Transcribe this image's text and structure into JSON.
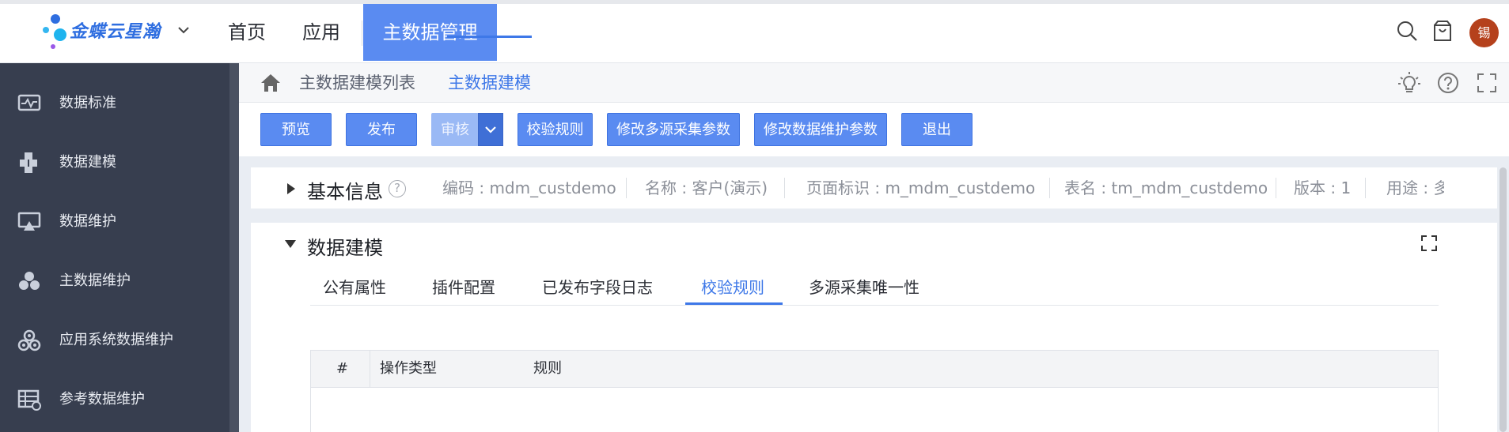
{
  "header": {
    "brand": "金蝶云星瀚",
    "nav": [
      "首页",
      "应用",
      "主数据管理"
    ],
    "avatar_text": "锡"
  },
  "sidebar": {
    "items": [
      {
        "label": "数据标准",
        "icon": "chart-monitor-icon"
      },
      {
        "label": "数据建模",
        "icon": "blocks-icon"
      },
      {
        "label": "数据维护",
        "icon": "monitor-icon"
      },
      {
        "label": "主数据维护",
        "icon": "cluster-icon"
      },
      {
        "label": "应用系统数据维护",
        "icon": "gears-icon"
      },
      {
        "label": "参考数据维护",
        "icon": "table-icon"
      }
    ]
  },
  "breadcrumb": {
    "items": [
      "主数据建模列表",
      "主数据建模"
    ]
  },
  "toolbar": {
    "buttons": [
      "预览",
      "发布",
      "审核",
      "校验规则",
      "修改多源采集参数",
      "修改数据维护参数",
      "退出"
    ]
  },
  "basic_info": {
    "title": "基本信息",
    "fields": [
      "编码 : mdm_custdemo",
      "名称 : 客户(演示)",
      "页面标识 : m_mdm_custdemo",
      "表名 : tm_mdm_custdemo",
      "版本 : 1",
      "用途 : 多"
    ]
  },
  "modeling": {
    "title": "数据建模",
    "tabs": [
      "公有属性",
      "插件配置",
      "已发布字段日志",
      "校验规则",
      "多源采集唯一性"
    ],
    "active_tab": "校验规则",
    "table_headers": [
      "#",
      "操作类型",
      "规则"
    ]
  },
  "colors": {
    "accent": "#5a8bf1",
    "sidebar": "#373e4f",
    "avatar": "#b5411c"
  }
}
